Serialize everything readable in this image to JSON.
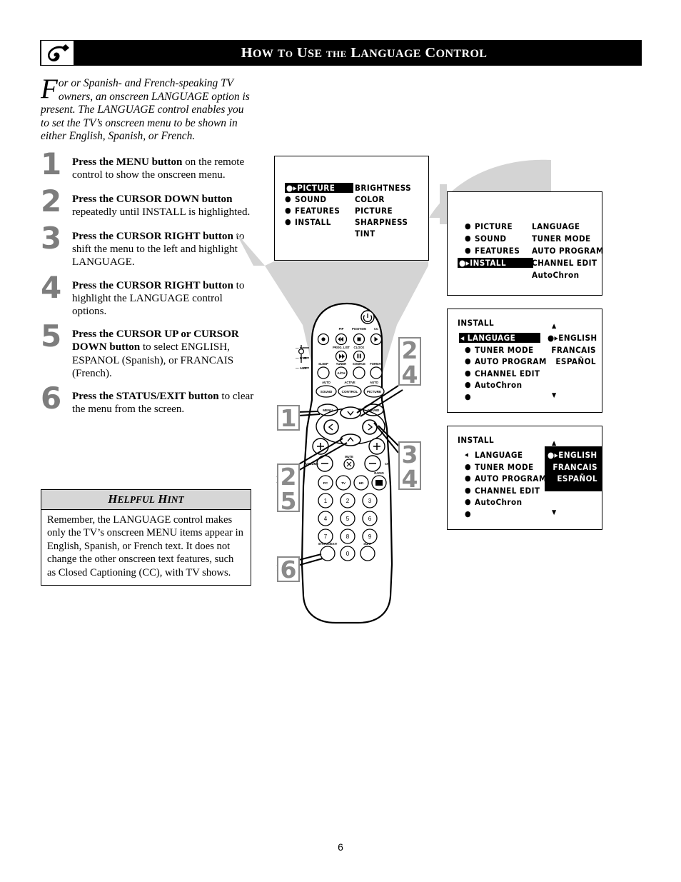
{
  "header": {
    "title_parts": [
      {
        "t": "H",
        "big": true
      },
      {
        "t": "OW",
        "big": false
      },
      {
        "t": " ",
        "big": false
      },
      {
        "t": "T",
        "big": true
      },
      {
        "t": "O",
        "big": false
      },
      {
        "t": " ",
        "big": false
      },
      {
        "t": "U",
        "big": true
      },
      {
        "t": "SE",
        "big": false
      },
      {
        "t": " ",
        "big": false
      },
      {
        "t": "THE",
        "big": false
      },
      {
        "t": " ",
        "big": false
      },
      {
        "t": "L",
        "big": true
      },
      {
        "t": "ANGUAGE",
        "big": false
      },
      {
        "t": " ",
        "big": false
      },
      {
        "t": "C",
        "big": true
      },
      {
        "t": "ONTROL",
        "big": false
      }
    ],
    "title_plain": "How to Use the Language Control",
    "logo_icon": "philips-swoosh-logo-icon"
  },
  "intro": {
    "dropcap": "F",
    "text": "or or Spanish- and French-speaking TV owners, an onscreen LANGUAGE option is present.  The LANGUAGE control enables you to set the TV’s onscreen menu to be shown in either English, Spanish, or French."
  },
  "steps": [
    {
      "num": "1",
      "bold": "Press the MENU button",
      "rest": " on the remote control to show the onscreen menu."
    },
    {
      "num": "2",
      "bold": "Press the CURSOR DOWN button",
      "rest": " repeatedly until INSTALL is highlighted."
    },
    {
      "num": "3",
      "bold": "Press the CURSOR RIGHT button",
      "rest": " to shift the menu to the left and highlight LANGUAGE."
    },
    {
      "num": "4",
      "bold": "Press the CURSOR RIGHT button",
      "rest": " to highlight the LANGUAGE control options."
    },
    {
      "num": "5",
      "bold": "Press the CURSOR UP or CURSOR DOWN button",
      "rest": " to select ENGLISH, ESPANOL (Spanish), or FRANCAIS (French)."
    },
    {
      "num": "6",
      "bold": "Press the STATUS/EXIT button",
      "rest": " to clear the menu from the screen."
    }
  ],
  "hint": {
    "title_h": "H",
    "title_elpful": "ELPFUL",
    "title_h2": "H",
    "title_int": "INT",
    "title_plain": "Helpful Hint",
    "body": "Remember, the LANGUAGE control makes only the TV’s onscreen MENU items appear in English, Spanish, or French text.  It does not change the other onscreen text features, such as Closed Captioning (CC), with TV shows."
  },
  "menus": {
    "menu1": {
      "left_items": [
        {
          "label": "PICTURE",
          "selected": true,
          "marker": "●▸"
        },
        {
          "label": "SOUND",
          "selected": false,
          "marker": "●"
        },
        {
          "label": "FEATURES",
          "selected": false,
          "marker": "●"
        },
        {
          "label": "INSTALL",
          "selected": false,
          "marker": "●"
        }
      ],
      "right_items": [
        "BRIGHTNESS",
        "COLOR",
        "PICTURE",
        "SHARPNESS",
        "TINT"
      ]
    },
    "menu2": {
      "left_items": [
        {
          "label": "PICTURE",
          "selected": false,
          "marker": "●"
        },
        {
          "label": "SOUND",
          "selected": false,
          "marker": "●"
        },
        {
          "label": "FEATURES",
          "selected": false,
          "marker": "●"
        },
        {
          "label": "INSTALL",
          "selected": true,
          "marker": "●▸"
        }
      ],
      "right_items": [
        "LANGUAGE",
        "TUNER MODE",
        "AUTO PROGRAM",
        "CHANNEL EDIT",
        "AutoChron"
      ]
    },
    "menu3": {
      "title": "INSTALL",
      "left_items": [
        {
          "label": "LANGUAGE",
          "selected": true,
          "marker": "◂"
        },
        {
          "label": "TUNER MODE",
          "selected": false,
          "marker": "●"
        },
        {
          "label": "AUTO PROGRAM",
          "selected": false,
          "marker": "●"
        },
        {
          "label": "CHANNEL EDIT",
          "selected": false,
          "marker": "●"
        },
        {
          "label": "AutoChron",
          "selected": false,
          "marker": "●"
        },
        {
          "label": "",
          "selected": false,
          "marker": "●"
        }
      ],
      "right_items": [
        {
          "label": "ENGLISH",
          "marker": "●▸"
        },
        {
          "label": "FRANCAIS",
          "marker": ""
        },
        {
          "label": "ESPAÑOL",
          "marker": ""
        }
      ],
      "right_highlighted": false,
      "scroll_up": "▲",
      "scroll_down": "▼"
    },
    "menu4": {
      "title": "INSTALL",
      "left_items": [
        {
          "label": "LANGUAGE",
          "selected": false,
          "marker": "◂"
        },
        {
          "label": "TUNER MODE",
          "selected": false,
          "marker": "●"
        },
        {
          "label": "AUTO PROGRAM",
          "selected": false,
          "marker": "●"
        },
        {
          "label": "CHANNEL EDIT",
          "selected": false,
          "marker": "●"
        },
        {
          "label": "AutoChron",
          "selected": false,
          "marker": "●"
        },
        {
          "label": "",
          "selected": false,
          "marker": "●"
        }
      ],
      "right_items": [
        {
          "label": "ENGLISH",
          "marker": "●▸"
        },
        {
          "label": "FRANCAIS",
          "marker": ""
        },
        {
          "label": "ESPAÑOL",
          "marker": ""
        }
      ],
      "right_highlighted": true,
      "scroll_up": "▲",
      "scroll_down": "▼"
    }
  },
  "callouts": [
    {
      "id": "callout-1",
      "lines": [
        "1"
      ]
    },
    {
      "id": "callout-25",
      "lines": [
        "2",
        "5"
      ]
    },
    {
      "id": "callout-6",
      "lines": [
        "6"
      ]
    },
    {
      "id": "callout-24",
      "lines": [
        "2",
        "4"
      ]
    },
    {
      "id": "callout-34",
      "lines": [
        "3",
        "4"
      ]
    }
  ],
  "remote": {
    "name": "tv-remote-control",
    "mode_labels": [
      "TV",
      "DVD",
      "AUX"
    ],
    "top_labels": [
      "PIP",
      "POSITION",
      "CC"
    ],
    "second_labels": [
      "PROG. LIST",
      "CLOCK"
    ],
    "third_labels": [
      "SLEEP",
      "TUNER",
      "SOURCE",
      "FORMAT"
    ],
    "aux_button": "A/CH",
    "fourth_labels": [
      "AUTO",
      "ACTIVE",
      "AUTO"
    ],
    "fourth_buttons": [
      "SOUND",
      "CONTROL",
      "PICTURE"
    ],
    "menu_button": "MENU",
    "sound_button": "SOUND",
    "mute_label": "MUTE",
    "vol_label": "VOLUME",
    "ch_label": "CH",
    "radio_label": "RADIO",
    "source_row": [
      "PC",
      "TV",
      "HD"
    ],
    "keypad": [
      "1",
      "2",
      "3",
      "4",
      "5",
      "6",
      "7",
      "8",
      "9",
      "0"
    ],
    "status_exit_label": "STATUS/EXIT",
    "surf_label": "SURF"
  },
  "page_number": "6",
  "colors": {
    "header_bg": "#000000",
    "header_fg": "#ffffff",
    "step_number": "#7d7d7d",
    "callout_border": "#8a8a8a",
    "callout_text": "#8a8a8a",
    "hint_header_bg": "#d6d6d6",
    "beam_gray": "#d4d4d4",
    "menu_bg": "#ffffff",
    "menu_highlight_bg": "#000000"
  }
}
